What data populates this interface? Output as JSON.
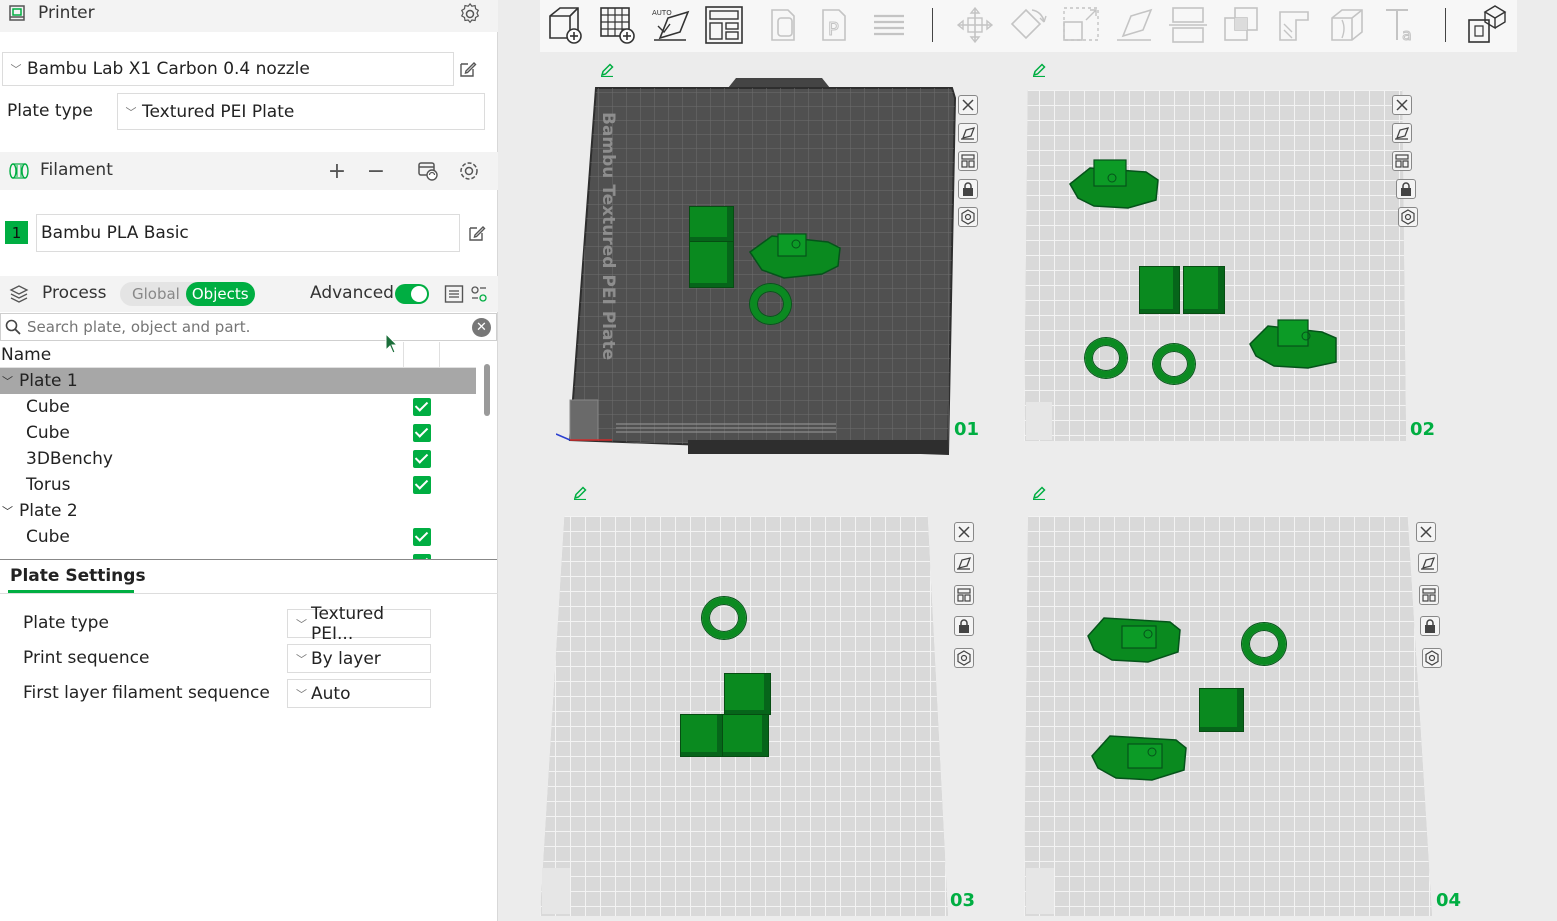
{
  "printer": {
    "section_title": "Printer",
    "name": "Bambu Lab X1 Carbon 0.4 nozzle",
    "plate_type_label": "Plate type",
    "plate_type_value": "Textured PEI Plate"
  },
  "filament": {
    "section_title": "Filament",
    "index": "1",
    "name": "Bambu PLA Basic",
    "color": "#00ae42"
  },
  "process": {
    "section_title": "Process",
    "mode_global": "Global",
    "mode_objects": "Objects",
    "advanced_label": "Advanced"
  },
  "search": {
    "placeholder": "Search plate, object and part."
  },
  "tree": {
    "name_header": "Name",
    "rows": [
      {
        "label": "Plate 1"
      },
      {
        "label": "Cube"
      },
      {
        "label": "Cube"
      },
      {
        "label": "3DBenchy"
      },
      {
        "label": "Torus"
      },
      {
        "label": "Plate 2"
      },
      {
        "label": "Cube"
      }
    ]
  },
  "plate_settings": {
    "tab_label": "Plate Settings",
    "plate_type_label": "Plate type",
    "plate_type_value": "Textured PEI...",
    "print_sequence_label": "Print sequence",
    "print_sequence_value": "By layer",
    "first_layer_label": "First layer filament sequence",
    "first_layer_value": "Auto"
  },
  "plates": [
    {
      "number": "01",
      "bed_text": "Bambu Textured PEI Plate"
    },
    {
      "number": "02"
    },
    {
      "number": "03"
    },
    {
      "number": "04"
    }
  ],
  "colors": {
    "accent": "#00ae42",
    "model": "#0a8a1f"
  }
}
